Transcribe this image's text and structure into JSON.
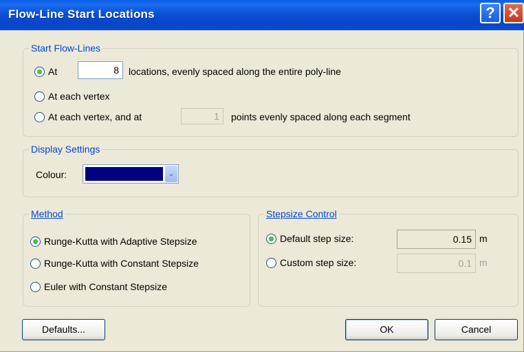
{
  "window": {
    "title": "Flow-Line Start Locations",
    "help_glyph": "?",
    "close_glyph": "✕"
  },
  "start_flow_lines": {
    "legend": "Start Flow-Lines",
    "option_at": {
      "label": "At",
      "value": "8",
      "suffix": "locations, evenly spaced along the entire poly-line",
      "selected": true
    },
    "option_vertex": {
      "label": "At each vertex",
      "selected": false
    },
    "option_vertex_and": {
      "label": "At each vertex, and at",
      "value": "1",
      "suffix": "points evenly spaced along each segment",
      "selected": false
    }
  },
  "display_settings": {
    "legend": "Display Settings",
    "colour_label": "Colour:",
    "colour_value": "#000080",
    "dropdown_glyph": "⌄"
  },
  "method": {
    "legend": "Method",
    "options": [
      {
        "label": "Runge-Kutta with Adaptive Stepsize",
        "selected": true
      },
      {
        "label": "Runge-Kutta with Constant Stepsize",
        "selected": false
      },
      {
        "label": "Euler with Constant Stepsize",
        "selected": false
      }
    ]
  },
  "stepsize_control": {
    "legend": "Stepsize Control",
    "default": {
      "label": "Default step size:",
      "value": "0.15",
      "unit": "m",
      "selected": true
    },
    "custom": {
      "label": "Custom step size:",
      "value": "0.1",
      "unit": "m",
      "selected": false
    }
  },
  "buttons": {
    "defaults": "Defaults...",
    "ok": "OK",
    "cancel": "Cancel"
  }
}
